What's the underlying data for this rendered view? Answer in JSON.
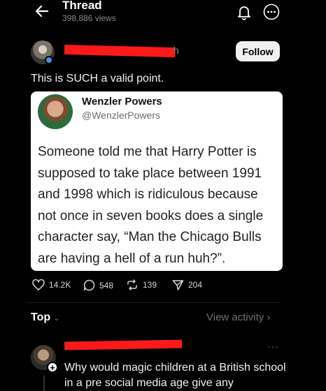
{
  "header": {
    "title": "Thread",
    "views": "398,886 views",
    "back_icon": "arrow-left-icon",
    "bell_icon": "bell-icon",
    "more_icon": "more-horizontal-icon"
  },
  "post": {
    "username_visible_tail": "h",
    "follow_label": "Follow",
    "text": "This is SUCH a valid point."
  },
  "quote": {
    "name": "Wenzler Powers",
    "handle": "@WenzlerPowers",
    "body": "Someone told me that Harry Potter is supposed to take place between 1991 and 1998 which is ridiculous because not once in seven books does a single character say, “Man the Chicago Bulls are having a hell of a run huh?”."
  },
  "actions": {
    "likes": "14.2K",
    "replies": "548",
    "reposts": "139",
    "shares": "204"
  },
  "replies_section": {
    "sort_label": "Top",
    "view_activity": "View activity"
  },
  "reply": {
    "more": "···",
    "text": "Why would magic children at a British school in a pre social media age give any"
  },
  "colors": {
    "background": "#000000",
    "redaction": "#ff1a1a",
    "muted": "#8a8a8a",
    "card": "#ffffff"
  }
}
